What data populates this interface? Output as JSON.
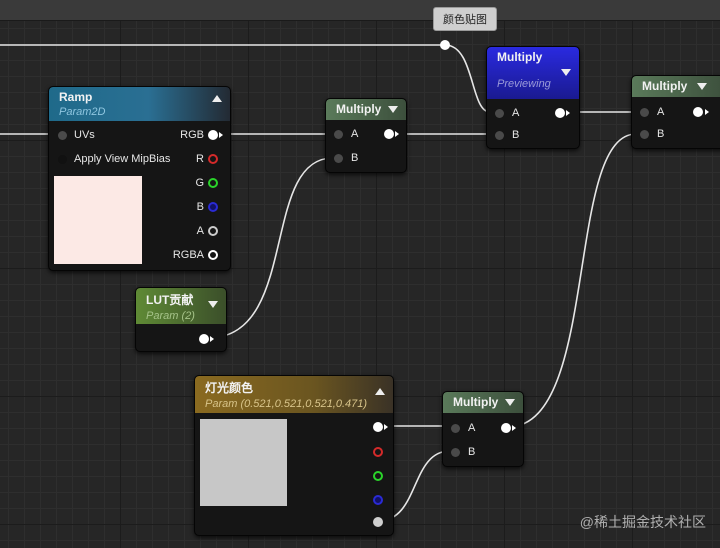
{
  "comment": {
    "label": "颜色贴图"
  },
  "ramp": {
    "title": "Ramp",
    "subtitle": "Param2D",
    "inputs": [
      "UVs",
      "Apply View MipBias"
    ],
    "outputs": [
      "RGB",
      "R",
      "G",
      "B",
      "A",
      "RGBA"
    ],
    "preview_color": "#fce9e5"
  },
  "multiply_a": {
    "title": "Multiply",
    "pin_a": "A",
    "pin_b": "B"
  },
  "multiply_preview": {
    "title": "Multiply",
    "subtitle": "Previewing",
    "pin_a": "A",
    "pin_b": "B"
  },
  "multiply_right": {
    "title": "Multiply",
    "pin_a": "A",
    "pin_b": "B"
  },
  "lut": {
    "title": "LUT贡献",
    "subtitle": "Param (2)"
  },
  "light": {
    "title": "灯光颜色",
    "subtitle": "Param (0.521,0.521,0.521,0.471)",
    "preview_color": "#c7c7c7"
  },
  "multiply_bottom": {
    "title": "Multiply",
    "pin_a": "A",
    "pin_b": "B"
  },
  "colors": {
    "red_pin": "#d42a2a",
    "green_pin": "#2ad42a",
    "blue_pin": "#2a2ad4",
    "texture_header": "#1f6a8a",
    "math_header": "#4f6a4f",
    "param_header": "#5a7a30",
    "vector_header": "#8a6a20",
    "preview_header": "#2020c0"
  },
  "watermark": "@稀土掘金技术社区"
}
